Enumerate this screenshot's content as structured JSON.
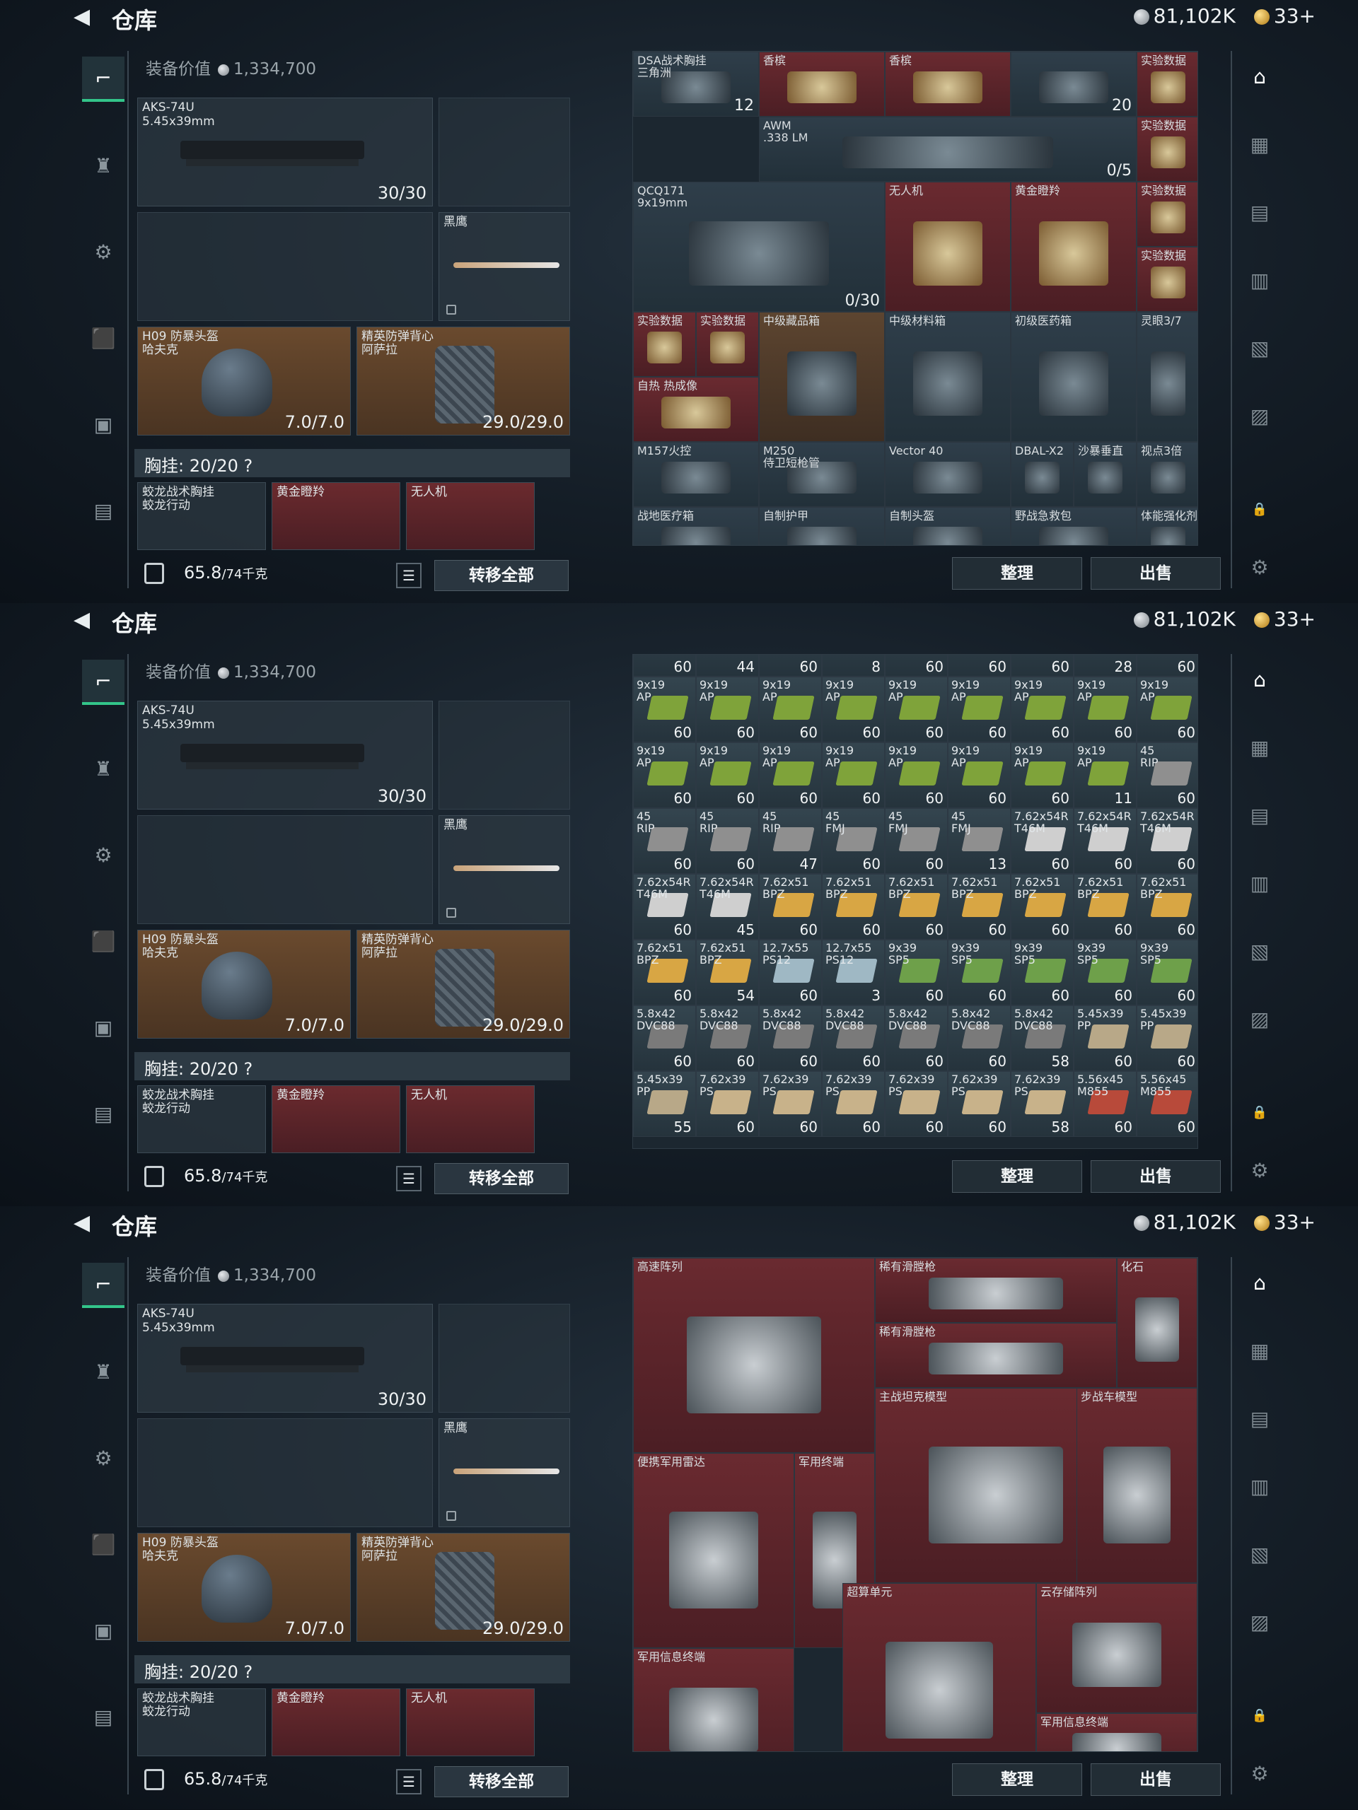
{
  "header": {
    "back": "◀",
    "title": "仓库",
    "silver": "81,102K",
    "gold": "33+"
  },
  "loadout": {
    "equip_value_label": "装备价值",
    "equip_value": "1,334,700",
    "primary": {
      "name": "AKS-74U",
      "ammo": "5.45x39mm",
      "count": "30/30"
    },
    "melee": {
      "name": "黑鹰"
    },
    "helmet": {
      "name": "H09 防暴头盔\n哈夫克",
      "count": "7.0/7.0"
    },
    "armor": {
      "name": "精英防弹背心\n阿萨拉",
      "count": "29.0/29.0"
    },
    "chest_rig": "胸挂: 20/20 ?",
    "rig_items": [
      "蛟龙战术胸挂\n蛟龙行动",
      "黄金瞪羚",
      "无人机"
    ],
    "weight": "65.8",
    "weight_max": "/74千克",
    "transfer_label": "转移全部"
  },
  "bottom_buttons": {
    "sort": "整理",
    "sell": "出售"
  },
  "screen1_items": [
    {
      "label": "DSA战术胸挂\n三角洲",
      "count": "12",
      "cls": ""
    },
    {
      "label": "香槟",
      "count": "",
      "cls": "r"
    },
    {
      "label": "香槟",
      "count": "",
      "cls": "r"
    },
    {
      "label": "",
      "count": "20",
      "cls": ""
    },
    {
      "label": "实验数据",
      "count": "",
      "cls": "r"
    },
    {
      "label": "AWM\n.338 LM",
      "count": "0/5",
      "cls": ""
    },
    {
      "label": "实验数据",
      "count": "",
      "cls": "r"
    },
    {
      "label": "QCQ171\n9x19mm",
      "count": "0/30",
      "cls": ""
    },
    {
      "label": "无人机",
      "count": "",
      "cls": "r"
    },
    {
      "label": "黄金瞪羚",
      "count": "",
      "cls": "r"
    },
    {
      "label": "实验数据",
      "count": "",
      "cls": "r"
    },
    {
      "label": "实验数据",
      "count": "",
      "cls": "r"
    },
    {
      "label": "实验数据",
      "count": "",
      "cls": "r"
    },
    {
      "label": "实验数据",
      "count": "",
      "cls": "r"
    },
    {
      "label": "中级藏品箱",
      "count": "",
      "cls": "b"
    },
    {
      "label": "中级材料箱",
      "count": "",
      "cls": ""
    },
    {
      "label": "初级医药箱",
      "count": "",
      "cls": ""
    },
    {
      "label": "灵眼3/7",
      "count": "",
      "cls": ""
    },
    {
      "label": "自热 热成像",
      "count": "",
      "cls": "r"
    },
    {
      "label": "M157火控",
      "count": "",
      "cls": ""
    },
    {
      "label": "M250\n侍卫短枪管",
      "count": "",
      "cls": ""
    },
    {
      "label": "Vector 40",
      "count": "",
      "cls": ""
    },
    {
      "label": "DBAL-X2",
      "count": "",
      "cls": ""
    },
    {
      "label": "沙暴垂直",
      "count": "",
      "cls": ""
    },
    {
      "label": "视点3倍",
      "count": "",
      "cls": ""
    },
    {
      "label": "战地医疗箱",
      "count": "",
      "cls": ""
    },
    {
      "label": "自制护甲",
      "count": "",
      "cls": ""
    },
    {
      "label": "自制头盔",
      "count": "",
      "cls": ""
    },
    {
      "label": "野战急救包",
      "count": "",
      "cls": ""
    },
    {
      "label": "体能强化剂",
      "count": "",
      "cls": ""
    }
  ],
  "screen2_rows": [
    {
      "labels": [
        "",
        "",
        "",
        "",
        "",
        "",
        "",
        "",
        ""
      ],
      "counts": [
        "60",
        "44",
        "60",
        "8",
        "60",
        "60",
        "60",
        "28",
        "60"
      ]
    },
    {
      "labels": [
        "9x19\nAP",
        "9x19\nAP",
        "9x19\nAP",
        "9x19\nAP",
        "9x19\nAP",
        "9x19\nAP",
        "9x19\nAP",
        "9x19\nAP",
        "9x19\nAP"
      ],
      "counts": [
        "60",
        "60",
        "60",
        "60",
        "60",
        "60",
        "60",
        "60",
        "60"
      ]
    },
    {
      "labels": [
        "9x19\nAP",
        "9x19\nAP",
        "9x19\nAP",
        "9x19\nAP",
        "9x19\nAP",
        "9x19\nAP",
        "9x19\nAP",
        "9x19\nAP",
        "45\nRIP"
      ],
      "counts": [
        "60",
        "60",
        "60",
        "60",
        "60",
        "60",
        "60",
        "11",
        "60"
      ]
    },
    {
      "labels": [
        "45\nRIP",
        "45\nRIP",
        "45\nRIP",
        "45\nFMJ",
        "45\nFMJ",
        "45\nFMJ",
        "7.62x54R\nT46M",
        "7.62x54R\nT46M",
        "7.62x54R\nT46M"
      ],
      "counts": [
        "60",
        "60",
        "47",
        "60",
        "60",
        "13",
        "60",
        "60",
        "60"
      ]
    },
    {
      "labels": [
        "7.62x54R\nT46M",
        "7.62x54R\nT46M",
        "7.62x51\nBPZ",
        "7.62x51\nBPZ",
        "7.62x51\nBPZ",
        "7.62x51\nBPZ",
        "7.62x51\nBPZ",
        "7.62x51\nBPZ",
        "7.62x51\nBPZ"
      ],
      "counts": [
        "60",
        "45",
        "60",
        "60",
        "60",
        "60",
        "60",
        "60",
        "60"
      ]
    },
    {
      "labels": [
        "7.62x51\nBPZ",
        "7.62x51\nBPZ",
        "12.7x55\nPS12",
        "12.7x55\nPS12",
        "9x39\nSP5",
        "9x39\nSP5",
        "9x39\nSP5",
        "9x39\nSP5",
        "9x39\nSP5"
      ],
      "counts": [
        "60",
        "54",
        "60",
        "3",
        "60",
        "60",
        "60",
        "60",
        "60"
      ]
    },
    {
      "labels": [
        "5.8x42\nDVC88",
        "5.8x42\nDVC88",
        "5.8x42\nDVC88",
        "5.8x42\nDVC88",
        "5.8x42\nDVC88",
        "5.8x42\nDVC88",
        "5.8x42\nDVC88",
        "5.45x39\nPP",
        "5.45x39\nPP"
      ],
      "counts": [
        "60",
        "60",
        "60",
        "60",
        "60",
        "60",
        "58",
        "60",
        "60"
      ]
    },
    {
      "labels": [
        "5.45x39\nPP",
        "7.62x39\nPS",
        "7.62x39\nPS",
        "7.62x39\nPS",
        "7.62x39\nPS",
        "7.62x39\nPS",
        "7.62x39\nPS",
        "5.56x45\nM855",
        "5.56x45\nM855"
      ],
      "counts": [
        "55",
        "60",
        "60",
        "60",
        "60",
        "60",
        "58",
        "60",
        "60"
      ]
    }
  ],
  "screen3_items": [
    {
      "label": "高速阵列",
      "cls": "r"
    },
    {
      "label": "稀有滑膛枪",
      "cls": "r"
    },
    {
      "label": "化石",
      "cls": "r"
    },
    {
      "label": "稀有滑膛枪",
      "cls": "r"
    },
    {
      "label": "主战坦克模型",
      "cls": "r"
    },
    {
      "label": "步战车模型",
      "cls": "r"
    },
    {
      "label": "便携军用雷达",
      "cls": "r"
    },
    {
      "label": "军用终端",
      "cls": "r"
    },
    {
      "label": "超算单元",
      "cls": "r"
    },
    {
      "label": "云存储阵列",
      "cls": "r"
    },
    {
      "label": "军用信息终端",
      "cls": "r"
    },
    {
      "label": "军用信息终端",
      "cls": "r"
    }
  ],
  "ammo_colors": {
    "9x19": "#7fa33a",
    "45": "#8f8f8f",
    "7.62x54R": "#cfcfcf",
    "7.62x51": "#d8a644",
    "12.7x55": "#9fb8c4",
    "9x39": "#6ea04a",
    "5.8x42": "#7a7a7a",
    "5.45x39": "#b8a888",
    "7.62x39": "#c8b28a",
    "5.56x45": "#b84a3a"
  },
  "icons": {
    "weapon": "pistol-icon",
    "armor": "vest-icon",
    "helmet": "helmet-icon",
    "backpack": "backpack-icon",
    "case": "case-icon",
    "briefcase": "briefcase-icon",
    "settings": "gear-icon"
  }
}
